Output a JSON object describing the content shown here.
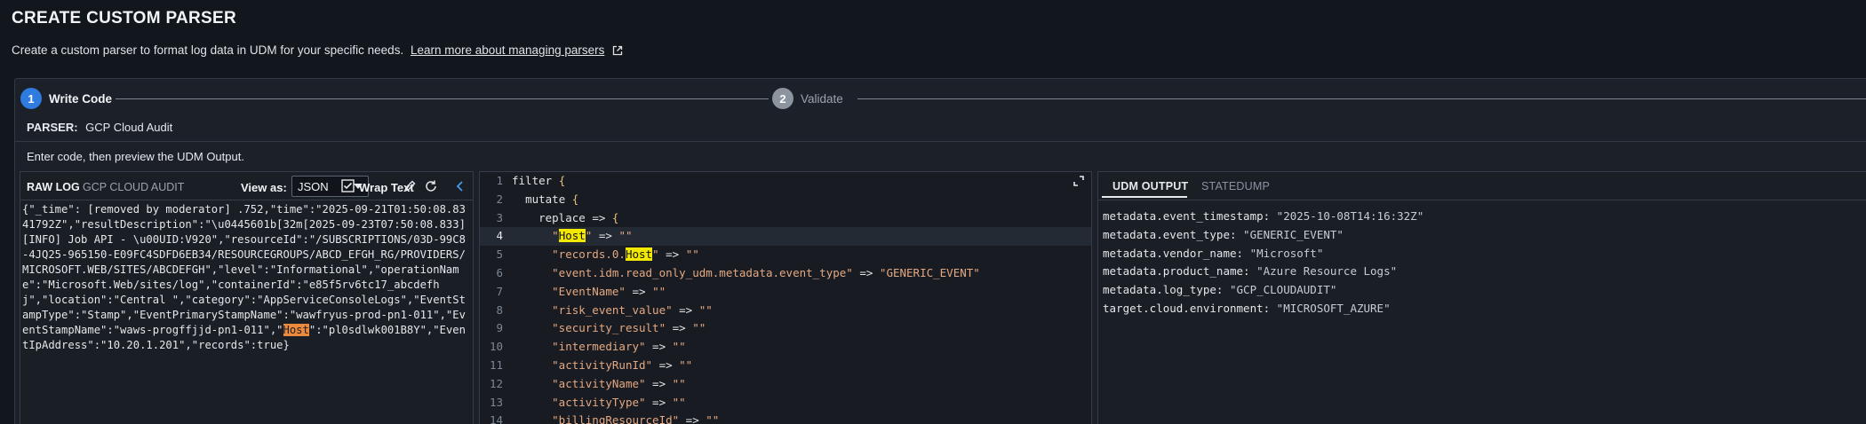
{
  "header": {
    "title": "CREATE CUSTOM PARSER",
    "subtitle": "Create a custom parser to format log data in UDM for your specific needs.",
    "learn_more_link": "Learn more about managing parsers"
  },
  "stepper": {
    "steps": [
      {
        "number": "1",
        "label": "Write Code",
        "state": "active"
      },
      {
        "number": "2",
        "label": "Validate",
        "state": "inactive"
      }
    ]
  },
  "parser": {
    "label": "PARSER:",
    "value": "GCP Cloud Audit"
  },
  "instruction": "Enter code, then preview the UDM Output.",
  "raw_log": {
    "title": "RAW LOG",
    "subtitle": "GCP CLOUD AUDIT",
    "view_as_label": "View as:",
    "view_as_value": "JSON",
    "wrap_text_label": "Wrap Text",
    "content_before": "{\"_time\": [removed by moderator] .752,\"time\":\"2025-09-21T01:50:08.8341792Z\",\"resultDescription\":\"\\u0445601b[32m[2025-09-23T07:50:08.833] [INFO] Job API - \\u00UID:V920\",\"resourceId\":\"/SUBSCRIPTIONS/03D-99C8-4JQ25-965150-E09FC4SDFD6EB34/RESOURCEGROUPS/ABCD_EFGH_RG/PROVIDERS/MICROSOFT.WEB/SITES/ABCDEFGH\",\"level\":\"Informational\",\"operationName\":\"Microsoft.Web/sites/log\",\"containerId\":\"e85f5rv6tc17_abcdefhj\",\"location\":\"Central \",\"category\":\"AppServiceConsoleLogs\",\"EventStampType\":\"Stamp\",\"EventPrimaryStampName\":\"wawfryus-prod-pn1-011\",\"EventStampName\":\"waws-progffjjd-pn1-011\",\"",
    "content_highlight": "Host",
    "content_after": "\":\"pl0sdlwk001B8Y\",\"EventIpAddress\":\"10.20.1.201\",\"records\":true}"
  },
  "code_editor": {
    "lines": [
      {
        "n": "1",
        "pre": "",
        "kw": "filter",
        "post": " ",
        "brace": "{",
        "active": false
      },
      {
        "n": "2",
        "pre": "  ",
        "kw": "mutate",
        "post": " ",
        "brace": "{",
        "active": false
      },
      {
        "n": "3",
        "pre": "    ",
        "kw": "replace => ",
        "post": "",
        "brace": "{",
        "active": false
      },
      {
        "n": "4",
        "pre": "      ",
        "q1": "\"",
        "hl": "Host",
        "q2": "\"",
        "rest": " => ",
        "val": "\"\"",
        "active": true
      },
      {
        "n": "5",
        "pre": "      ",
        "q1": "\"records.0.",
        "hl": "Host",
        "q2": "\"",
        "rest": " => ",
        "val": "\"\"",
        "active": false
      },
      {
        "n": "6",
        "pre": "      ",
        "key": "\"event.idm.read_only_udm.metadata.event_type\"",
        "rest": " => ",
        "val": "\"GENERIC_EVENT\"",
        "active": false
      },
      {
        "n": "7",
        "pre": "      ",
        "key": "\"EventName\"",
        "rest": " => ",
        "val": "\"\"",
        "active": false
      },
      {
        "n": "8",
        "pre": "      ",
        "key": "\"risk_event_value\"",
        "rest": " => ",
        "val": "\"\"",
        "active": false
      },
      {
        "n": "9",
        "pre": "      ",
        "key": "\"security_result\"",
        "rest": " => ",
        "val": "\"\"",
        "active": false
      },
      {
        "n": "10",
        "pre": "      ",
        "key": "\"intermediary\"",
        "rest": " => ",
        "val": "\"\"",
        "active": false
      },
      {
        "n": "11",
        "pre": "      ",
        "key": "\"activityRunId\"",
        "rest": " => ",
        "val": "\"\"",
        "active": false
      },
      {
        "n": "12",
        "pre": "      ",
        "key": "\"activityName\"",
        "rest": " => ",
        "val": "\"\"",
        "active": false
      },
      {
        "n": "13",
        "pre": "      ",
        "key": "\"activityType\"",
        "rest": " => ",
        "val": "\"\"",
        "active": false
      },
      {
        "n": "14",
        "pre": "      ",
        "key": "\"billingResourceId\"",
        "rest": " => ",
        "val": "\"\"",
        "active": false
      }
    ]
  },
  "udm_output": {
    "tabs": [
      "UDM OUTPUT",
      "STATEDUMP"
    ],
    "lines": [
      {
        "key": "metadata.event_timestamp: ",
        "value": "\"2025-10-08T14:16:32Z\""
      },
      {
        "key": "metadata.event_type: ",
        "value": "\"GENERIC_EVENT\""
      },
      {
        "key": "metadata.vendor_name: ",
        "value": "\"Microsoft\""
      },
      {
        "key": "metadata.product_name: ",
        "value": "\"Azure Resource Logs\""
      },
      {
        "key": "metadata.log_type: ",
        "value": "\"GCP_CLOUDAUDIT\""
      },
      {
        "key": "target.cloud.environment: ",
        "value": "\"MICROSOFT_AZURE\""
      }
    ]
  },
  "colors": {
    "accent": "#2f7be0",
    "highlight_yellow": "#f3e900",
    "highlight_orange": "#ec8a3b",
    "background": "#12161d"
  },
  "icons": [
    "external-link-icon",
    "checkbox-checked-icon",
    "pencil-icon",
    "refresh-icon",
    "chevron-left-icon",
    "expand-icon",
    "caret-down-icon"
  ]
}
